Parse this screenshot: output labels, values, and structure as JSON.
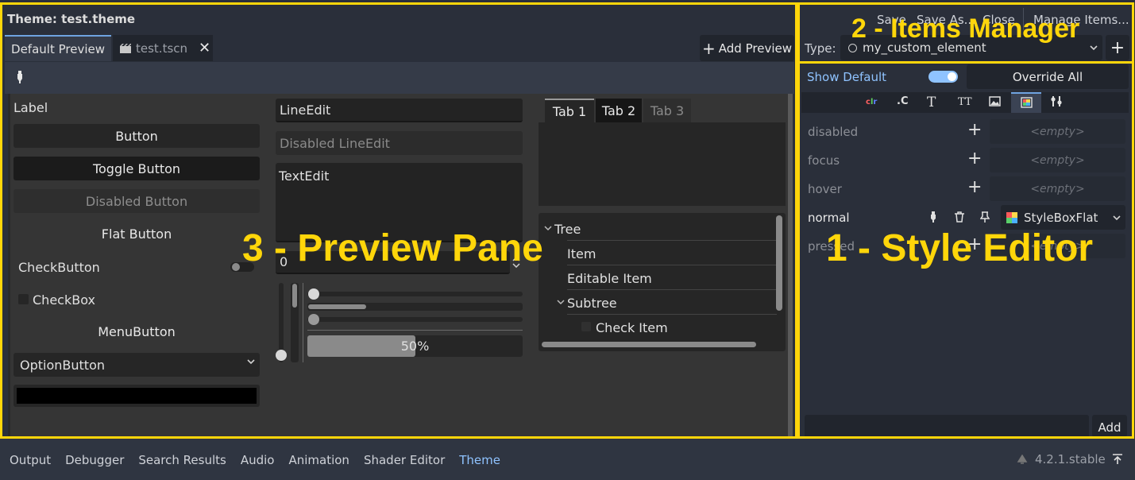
{
  "window_title": "Theme: test.theme",
  "preview_tabs": [
    {
      "label": "Default Preview"
    },
    {
      "label": "test.tscn"
    }
  ],
  "add_preview_label": "Add Preview",
  "top_menu": {
    "save": "Save",
    "save_as": "Save As...",
    "close": "Close",
    "manage_items": "Manage Items..."
  },
  "type_label": "Type:",
  "type_value": "my_custom_element",
  "show_default_label": "Show Default",
  "override_all_label": "Override All",
  "style_items": [
    {
      "name": "disabled",
      "value": "<empty>"
    },
    {
      "name": "focus",
      "value": "<empty>"
    },
    {
      "name": "hover",
      "value": "<empty>"
    },
    {
      "name": "normal",
      "value": "StyleBoxFlat"
    },
    {
      "name": "pressed",
      "value": "<empty>"
    }
  ],
  "add_button_label": "Add",
  "preview": {
    "label": "Label",
    "button": "Button",
    "toggle_button": "Toggle Button",
    "disabled_button": "Disabled Button",
    "flat_button": "Flat Button",
    "check_button": "CheckButton",
    "check_box": "CheckBox",
    "menu_button": "MenuButton",
    "option_button": "OptionButton",
    "line_edit": "LineEdit",
    "disabled_line_edit": "Disabled LineEdit",
    "text_edit": "TextEdit",
    "spin_value": "0",
    "progress": 0.5,
    "progress_label": "50%",
    "tabs": [
      "Tab 1",
      "Tab 2",
      "Tab 3"
    ],
    "tree": {
      "root": "Tree",
      "item": "Item",
      "editable": "Editable Item",
      "subtree": "Subtree",
      "check": "Check Item"
    }
  },
  "overlays": {
    "style_editor": "1 - Style Editor",
    "items_manager": "2 - Items Manager",
    "preview_pane": "3 - Preview Pane"
  },
  "bottom_tabs": [
    "Output",
    "Debugger",
    "Search Results",
    "Audio",
    "Animation",
    "Shader Editor",
    "Theme"
  ],
  "version": "4.2.1.stable",
  "colors": {
    "accent": "#8fc3ff",
    "highlight": "#ffd60a",
    "panel": "#2a2f3a"
  }
}
